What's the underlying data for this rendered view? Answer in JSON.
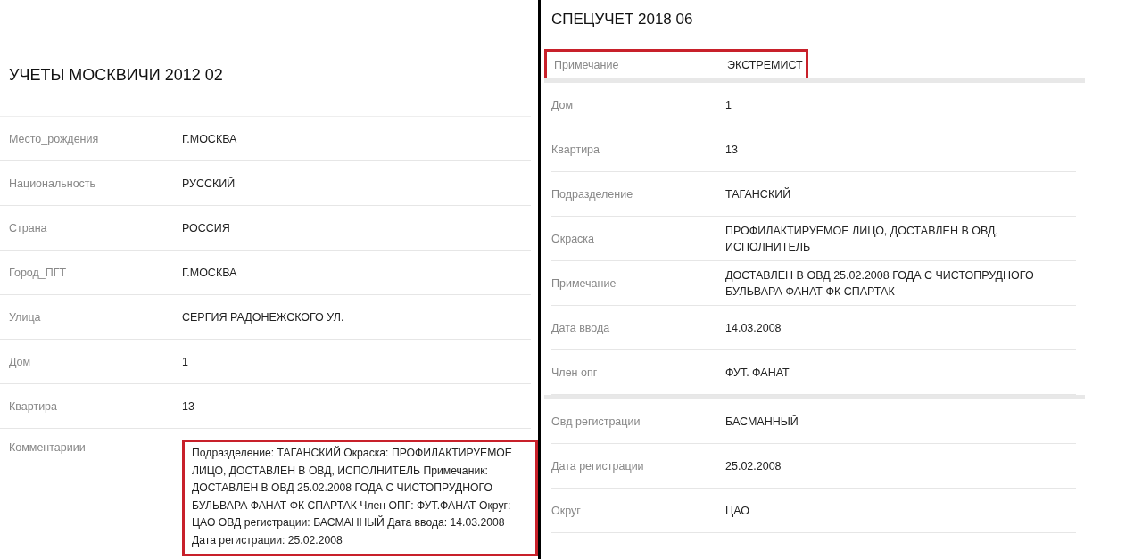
{
  "left": {
    "title": "УЧЕТЫ МОСКВИЧИ 2012 02",
    "rows": [
      {
        "label": "Место_рождения",
        "value": "Г.МОСКВА",
        "highlighted": false
      },
      {
        "label": "Национальность",
        "value": "РУССКИЙ",
        "highlighted": false
      },
      {
        "label": "Страна",
        "value": "РОССИЯ",
        "highlighted": false
      },
      {
        "label": "Город_ПГТ",
        "value": "Г.МОСКВА",
        "highlighted": false
      },
      {
        "label": "Улица",
        "value": "СЕРГИЯ РАДОНЕЖСКОГО УЛ.",
        "highlighted": false
      },
      {
        "label": "Дом",
        "value": "1",
        "highlighted": false
      },
      {
        "label": "Квартира",
        "value": "13",
        "highlighted": false
      },
      {
        "label": "Комментариии",
        "value": "Подразделение: ТАГАНСКИЙ Окраска: ПРОФИЛАКТИРУЕМОЕ ЛИЦО, ДОСТАВЛЕН В ОВД, ИСПОЛНИТЕЛЬ Примечаник: ДОСТАВЛЕН В ОВД 25.02.2008 ГОДА С ЧИСТОПРУДНОГО БУЛЬВАРА ФАНАТ ФК СПАРТАК Член ОПГ: ФУТ.ФАНАТ Округ: ЦАО ОВД регистрации: БАСМАННЫЙ Дата ввода: 14.03.2008 Дата регистрации: 25.02.2008",
        "highlighted": true
      }
    ]
  },
  "right": {
    "title": "СПЕЦУЧЕТ 2018 06",
    "sections": [
      {
        "rows": [
          {
            "label": "Примечание",
            "value": "ЭКСТРЕМИСТ",
            "highlighted": true
          }
        ]
      },
      {
        "rows": [
          {
            "label": "Дом",
            "value": "1",
            "highlighted": false
          },
          {
            "label": "Квартира",
            "value": "13",
            "highlighted": false
          },
          {
            "label": "Подразделение",
            "value": "ТАГАНСКИЙ",
            "highlighted": false
          },
          {
            "label": "Окраска",
            "value": "ПРОФИЛАКТИРУЕМОЕ ЛИЦО, ДОСТАВЛЕН В ОВД, ИСПОЛНИТЕЛЬ",
            "highlighted": false
          },
          {
            "label": "Примечание",
            "value": "ДОСТАВЛЕН В ОВД 25.02.2008 ГОДА С ЧИСТОПРУДНОГО БУЛЬВАРА ФАНАТ ФК СПАРТАК",
            "highlighted": false
          },
          {
            "label": "Дата ввода",
            "value": "14.03.2008",
            "highlighted": false
          },
          {
            "label": "Член опг",
            "value": "ФУТ. ФАНАТ",
            "highlighted": false
          }
        ]
      },
      {
        "rows": [
          {
            "label": "Овд регистрации",
            "value": "БАСМАННЫЙ",
            "highlighted": false
          },
          {
            "label": "Дата регистрации",
            "value": "25.02.2008",
            "highlighted": false
          },
          {
            "label": "Округ",
            "value": "ЦАО",
            "highlighted": false
          }
        ]
      }
    ]
  }
}
